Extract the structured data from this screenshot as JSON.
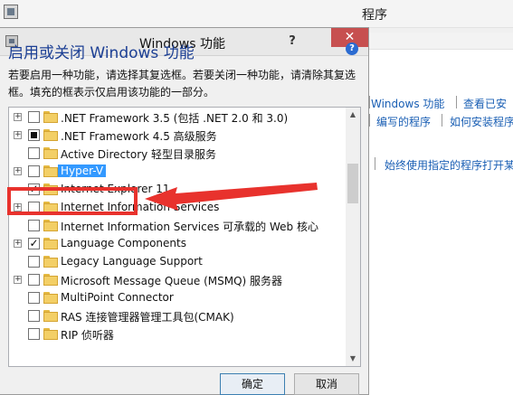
{
  "background_window": {
    "title": "程序",
    "links": [
      {
        "label": "Windows 功能"
      },
      {
        "label": "查看已安"
      },
      {
        "label": "编写的程序"
      },
      {
        "label": "如何安装程序"
      },
      {
        "label": "始终使用指定的程序打开某"
      }
    ]
  },
  "dialog": {
    "title": "Windows 功能",
    "help_glyph": "?",
    "close_glyph": "✕",
    "heading": "启用或关闭 Windows 功能",
    "description": "若要启用一种功能，请选择其复选框。若要关闭一种功能，请清除其复选框。填充的框表示仅启用该功能的一部分。",
    "features": [
      {
        "label": ".NET Framework 3.5 (包括 .NET 2.0 和 3.0)",
        "expandable": true,
        "state": "unchecked"
      },
      {
        "label": ".NET Framework 4.5 高级服务",
        "expandable": true,
        "state": "partial"
      },
      {
        "label": "Active Directory 轻型目录服务",
        "expandable": false,
        "state": "unchecked"
      },
      {
        "label": "Hyper-V",
        "expandable": true,
        "state": "unchecked",
        "selected": true
      },
      {
        "label": "Internet Explorer 11",
        "expandable": false,
        "state": "checked"
      },
      {
        "label": "Internet Information Services",
        "expandable": true,
        "state": "unchecked"
      },
      {
        "label": "Internet Information Services 可承载的 Web 核心",
        "expandable": false,
        "state": "unchecked"
      },
      {
        "label": "Language Components",
        "expandable": true,
        "state": "checked"
      },
      {
        "label": "Legacy Language Support",
        "expandable": false,
        "state": "unchecked"
      },
      {
        "label": "Microsoft Message Queue (MSMQ) 服务器",
        "expandable": true,
        "state": "unchecked"
      },
      {
        "label": "MultiPoint Connector",
        "expandable": false,
        "state": "unchecked"
      },
      {
        "label": "RAS 连接管理器管理工具包(CMAK)",
        "expandable": false,
        "state": "unchecked"
      },
      {
        "label": "RIP 侦听器",
        "expandable": false,
        "state": "unchecked"
      }
    ],
    "ok_label": "确定",
    "cancel_label": "取消"
  },
  "annotation": {
    "color": "#e8322d"
  }
}
